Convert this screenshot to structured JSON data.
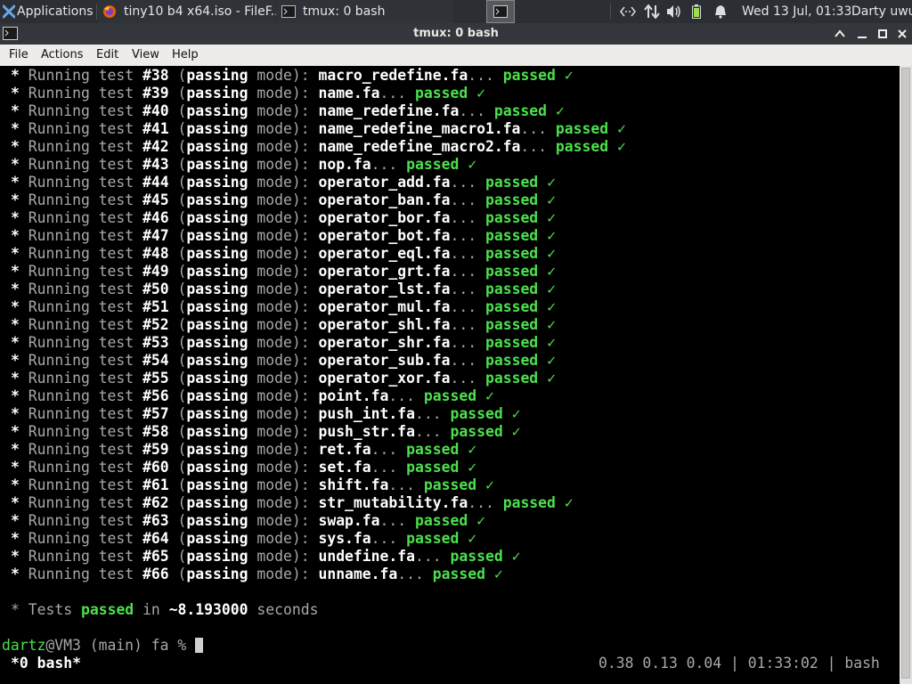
{
  "taskbar": {
    "apps_menu_label": "Applications",
    "tasks": [
      {
        "title": "tiny10 b4 x64.iso - FileF..."
      },
      {
        "title": "tmux: 0 bash"
      }
    ],
    "clock": "Wed 13 Jul, 01:33",
    "user": "Darty uwu"
  },
  "window": {
    "title": "tmux: 0 bash"
  },
  "menubar": {
    "items": [
      "File",
      "Actions",
      "Edit",
      "View",
      "Help"
    ]
  },
  "terminal": {
    "test_prefix": "Running test",
    "mode_label": "passing",
    "mode_word": "mode):",
    "passed_label": "passed",
    "check": "✓",
    "ellipsis": "...",
    "tests": [
      {
        "num": "#38",
        "file": "macro_redefine.fa"
      },
      {
        "num": "#39",
        "file": "name.fa"
      },
      {
        "num": "#40",
        "file": "name_redefine.fa"
      },
      {
        "num": "#41",
        "file": "name_redefine_macro1.fa"
      },
      {
        "num": "#42",
        "file": "name_redefine_macro2.fa"
      },
      {
        "num": "#43",
        "file": "nop.fa"
      },
      {
        "num": "#44",
        "file": "operator_add.fa"
      },
      {
        "num": "#45",
        "file": "operator_ban.fa"
      },
      {
        "num": "#46",
        "file": "operator_bor.fa"
      },
      {
        "num": "#47",
        "file": "operator_bot.fa"
      },
      {
        "num": "#48",
        "file": "operator_eql.fa"
      },
      {
        "num": "#49",
        "file": "operator_grt.fa"
      },
      {
        "num": "#50",
        "file": "operator_lst.fa"
      },
      {
        "num": "#51",
        "file": "operator_mul.fa"
      },
      {
        "num": "#52",
        "file": "operator_shl.fa"
      },
      {
        "num": "#53",
        "file": "operator_shr.fa"
      },
      {
        "num": "#54",
        "file": "operator_sub.fa"
      },
      {
        "num": "#55",
        "file": "operator_xor.fa"
      },
      {
        "num": "#56",
        "file": "point.fa"
      },
      {
        "num": "#57",
        "file": "push_int.fa"
      },
      {
        "num": "#58",
        "file": "push_str.fa"
      },
      {
        "num": "#59",
        "file": "ret.fa"
      },
      {
        "num": "#60",
        "file": "set.fa"
      },
      {
        "num": "#61",
        "file": "shift.fa"
      },
      {
        "num": "#62",
        "file": "str_mutability.fa"
      },
      {
        "num": "#63",
        "file": "swap.fa"
      },
      {
        "num": "#64",
        "file": "sys.fa"
      },
      {
        "num": "#65",
        "file": "undefine.fa"
      },
      {
        "num": "#66",
        "file": "unname.fa"
      }
    ],
    "summary": {
      "tests_label": "Tests",
      "passed_word": "passed",
      "in_label": "in",
      "duration": "~8.193000",
      "seconds_label": "seconds"
    },
    "prompt": {
      "user": "dartz",
      "host": "@VM3",
      "branch": "(main)",
      "dir": "fa",
      "symbol": "%"
    }
  },
  "tmux_status": {
    "window_label": "*0 bash*",
    "load": "0.38 0.13 0.04",
    "time": "01:33:02",
    "command": "bash"
  }
}
